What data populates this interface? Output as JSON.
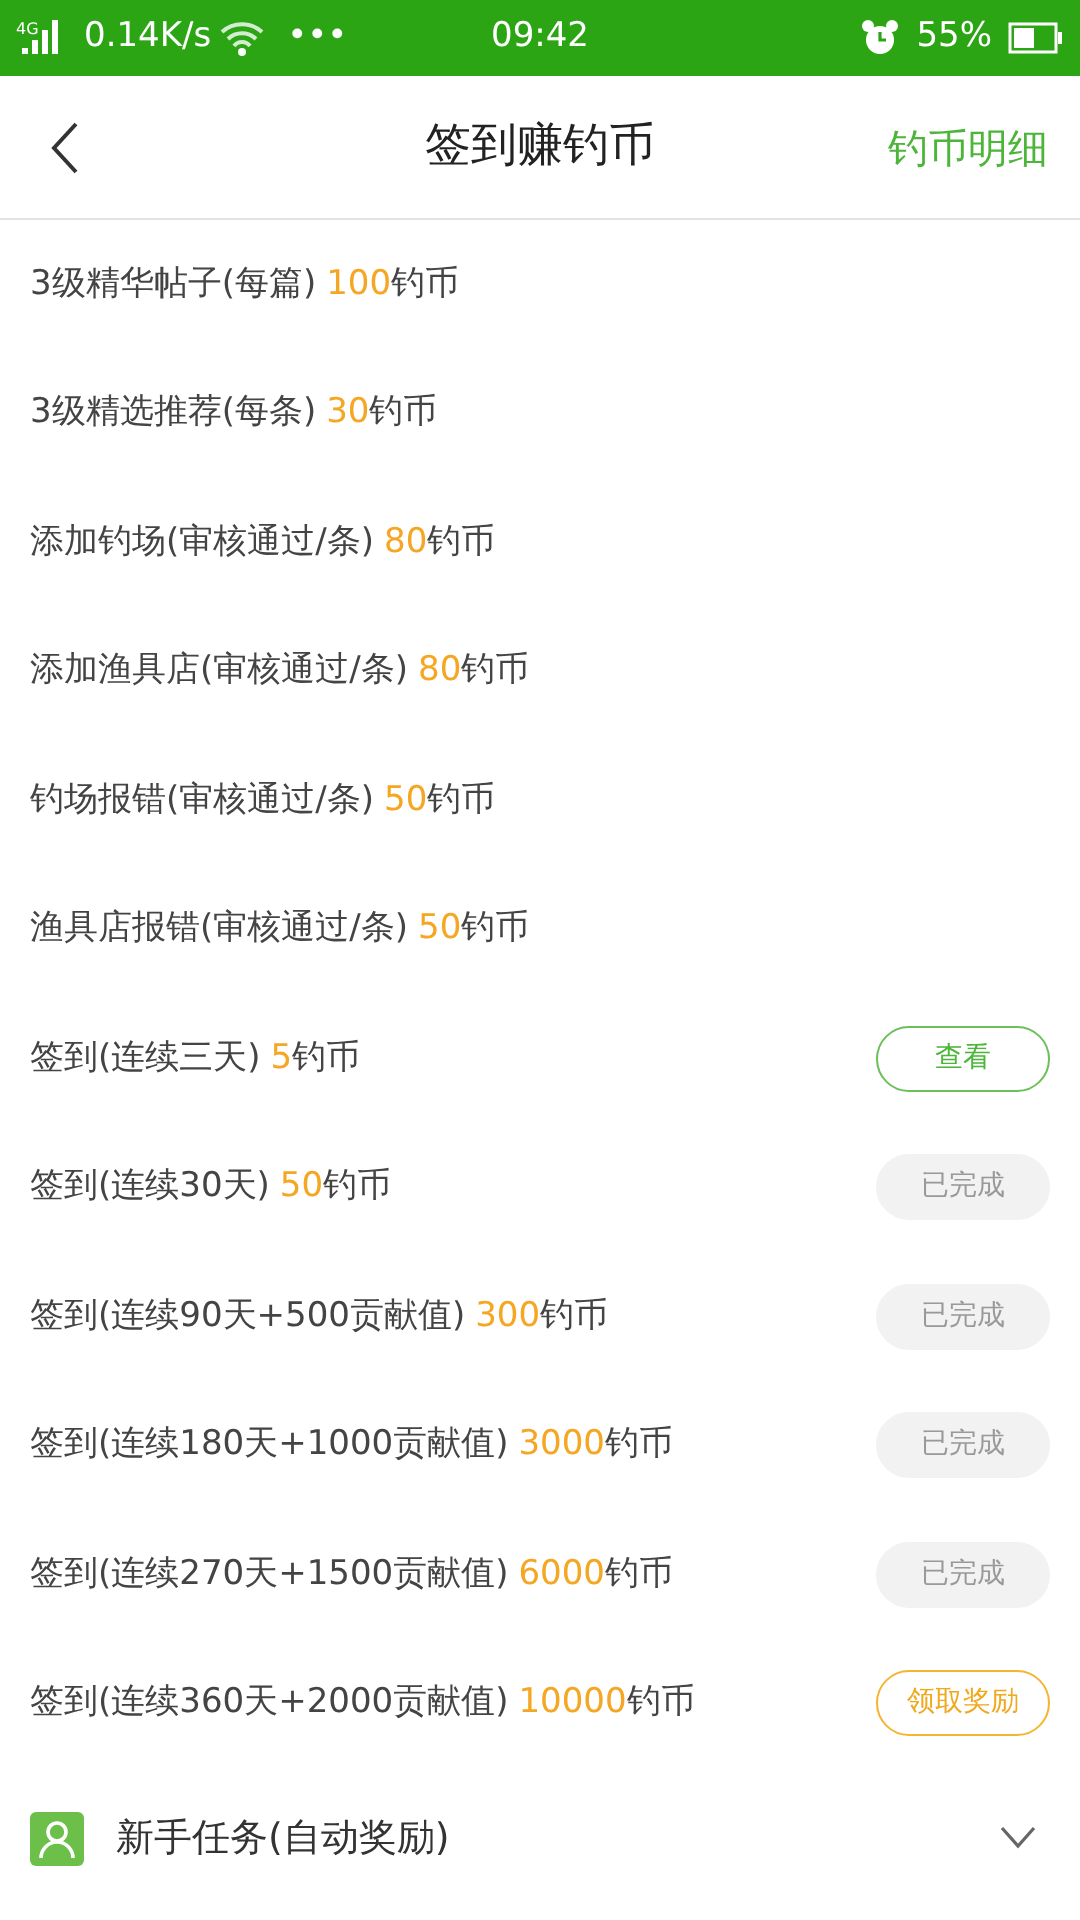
{
  "status_bar": {
    "network": "4G",
    "speed": "0.14K/s",
    "more": "•••",
    "time": "09:42",
    "battery": "55%"
  },
  "header": {
    "title": "签到赚钓币",
    "action": "钓币明细"
  },
  "tasks": [
    {
      "label": "3级精华帖子(每篇)",
      "amount": "100",
      "unit": "钓币"
    },
    {
      "label": "3级精选推荐(每条)",
      "amount": "30",
      "unit": "钓币"
    },
    {
      "label": "添加钓场(审核通过/条)",
      "amount": "80",
      "unit": "钓币"
    },
    {
      "label": "添加渔具店(审核通过/条)",
      "amount": "80",
      "unit": "钓币"
    },
    {
      "label": "钓场报错(审核通过/条)",
      "amount": "50",
      "unit": "钓币"
    },
    {
      "label": "渔具店报错(审核通过/条)",
      "amount": "50",
      "unit": "钓币"
    },
    {
      "label": "签到(连续三天)",
      "amount": "5",
      "unit": "钓币",
      "action": {
        "kind": "view",
        "label": "查看"
      }
    },
    {
      "label": "签到(连续30天)",
      "amount": "50",
      "unit": "钓币",
      "action": {
        "kind": "done",
        "label": "已完成"
      }
    },
    {
      "label": "签到(连续90天+500贡献值)",
      "amount": "300",
      "unit": "钓币",
      "action": {
        "kind": "done",
        "label": "已完成"
      }
    },
    {
      "label": "签到(连续180天+1000贡献值)",
      "amount": "3000",
      "unit": "钓币",
      "action": {
        "kind": "done",
        "label": "已完成"
      }
    },
    {
      "label": "签到(连续270天+1500贡献值)",
      "amount": "6000",
      "unit": "钓币",
      "action": {
        "kind": "done",
        "label": "已完成"
      }
    },
    {
      "label": "签到(连续360天+2000贡献值)",
      "amount": "10000",
      "unit": "钓币",
      "action": {
        "kind": "claim",
        "label": "领取奖励"
      }
    }
  ],
  "section": {
    "title": "新手任务(自动奖励)",
    "expanded": false
  }
}
